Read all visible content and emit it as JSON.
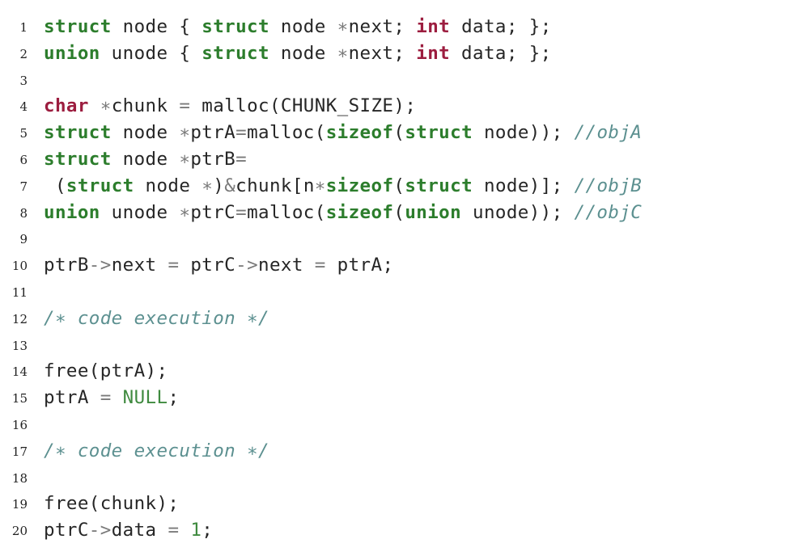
{
  "listing": {
    "lines": [
      {
        "number": "1",
        "tokens": [
          {
            "text": "struct",
            "kind": "type"
          },
          {
            "text": " node { ",
            "kind": "plain"
          },
          {
            "text": "struct",
            "kind": "type"
          },
          {
            "text": " node ",
            "kind": "plain"
          },
          {
            "text": "∗",
            "kind": "op"
          },
          {
            "text": "next; ",
            "kind": "plain"
          },
          {
            "text": "int",
            "kind": "prim"
          },
          {
            "text": " data; };",
            "kind": "plain"
          }
        ]
      },
      {
        "number": "2",
        "tokens": [
          {
            "text": "union",
            "kind": "type"
          },
          {
            "text": " unode { ",
            "kind": "plain"
          },
          {
            "text": "struct",
            "kind": "type"
          },
          {
            "text": " node ",
            "kind": "plain"
          },
          {
            "text": "∗",
            "kind": "op"
          },
          {
            "text": "next; ",
            "kind": "plain"
          },
          {
            "text": "int",
            "kind": "prim"
          },
          {
            "text": " data; };",
            "kind": "plain"
          }
        ]
      },
      {
        "number": "3",
        "tokens": []
      },
      {
        "number": "4",
        "tokens": [
          {
            "text": "char",
            "kind": "prim"
          },
          {
            "text": " ",
            "kind": "plain"
          },
          {
            "text": "∗",
            "kind": "op"
          },
          {
            "text": "chunk ",
            "kind": "plain"
          },
          {
            "text": "=",
            "kind": "op"
          },
          {
            "text": " malloc(CHUNK_SIZE);",
            "kind": "plain"
          }
        ]
      },
      {
        "number": "5",
        "tokens": [
          {
            "text": "struct",
            "kind": "type"
          },
          {
            "text": " node ",
            "kind": "plain"
          },
          {
            "text": "∗",
            "kind": "op"
          },
          {
            "text": "ptrA",
            "kind": "plain"
          },
          {
            "text": "=",
            "kind": "op"
          },
          {
            "text": "malloc(",
            "kind": "plain"
          },
          {
            "text": "sizeof",
            "kind": "type"
          },
          {
            "text": "(",
            "kind": "plain"
          },
          {
            "text": "struct",
            "kind": "type"
          },
          {
            "text": " node)); ",
            "kind": "plain"
          },
          {
            "text": "//objA",
            "kind": "comment"
          }
        ]
      },
      {
        "number": "6",
        "tokens": [
          {
            "text": "struct",
            "kind": "type"
          },
          {
            "text": " node ",
            "kind": "plain"
          },
          {
            "text": "∗",
            "kind": "op"
          },
          {
            "text": "ptrB",
            "kind": "plain"
          },
          {
            "text": "=",
            "kind": "op"
          }
        ]
      },
      {
        "number": "7",
        "tokens": [
          {
            "text": " (",
            "kind": "plain"
          },
          {
            "text": "struct",
            "kind": "type"
          },
          {
            "text": " node ",
            "kind": "plain"
          },
          {
            "text": "∗",
            "kind": "op"
          },
          {
            "text": ")",
            "kind": "plain"
          },
          {
            "text": "&",
            "kind": "op"
          },
          {
            "text": "chunk[n",
            "kind": "plain"
          },
          {
            "text": "∗",
            "kind": "op"
          },
          {
            "text": "sizeof",
            "kind": "type"
          },
          {
            "text": "(",
            "kind": "plain"
          },
          {
            "text": "struct",
            "kind": "type"
          },
          {
            "text": " node)]; ",
            "kind": "plain"
          },
          {
            "text": "//objB",
            "kind": "comment"
          }
        ]
      },
      {
        "number": "8",
        "tokens": [
          {
            "text": "union",
            "kind": "type"
          },
          {
            "text": " unode ",
            "kind": "plain"
          },
          {
            "text": "∗",
            "kind": "op"
          },
          {
            "text": "ptrC",
            "kind": "plain"
          },
          {
            "text": "=",
            "kind": "op"
          },
          {
            "text": "malloc(",
            "kind": "plain"
          },
          {
            "text": "sizeof",
            "kind": "type"
          },
          {
            "text": "(",
            "kind": "plain"
          },
          {
            "text": "union",
            "kind": "type"
          },
          {
            "text": " unode)); ",
            "kind": "plain"
          },
          {
            "text": "//objC",
            "kind": "comment"
          }
        ]
      },
      {
        "number": "9",
        "tokens": []
      },
      {
        "number": "10",
        "tokens": [
          {
            "text": "ptrB",
            "kind": "plain"
          },
          {
            "text": "->",
            "kind": "op"
          },
          {
            "text": "next ",
            "kind": "plain"
          },
          {
            "text": "=",
            "kind": "op"
          },
          {
            "text": " ptrC",
            "kind": "plain"
          },
          {
            "text": "->",
            "kind": "op"
          },
          {
            "text": "next ",
            "kind": "plain"
          },
          {
            "text": "=",
            "kind": "op"
          },
          {
            "text": " ptrA;",
            "kind": "plain"
          }
        ]
      },
      {
        "number": "11",
        "tokens": []
      },
      {
        "number": "12",
        "tokens": [
          {
            "text": "/∗ code execution ∗/",
            "kind": "comment"
          }
        ]
      },
      {
        "number": "13",
        "tokens": []
      },
      {
        "number": "14",
        "tokens": [
          {
            "text": "free(ptrA);",
            "kind": "plain"
          }
        ]
      },
      {
        "number": "15",
        "tokens": [
          {
            "text": "ptrA ",
            "kind": "plain"
          },
          {
            "text": "=",
            "kind": "op"
          },
          {
            "text": " ",
            "kind": "plain"
          },
          {
            "text": "NULL",
            "kind": "lit"
          },
          {
            "text": ";",
            "kind": "plain"
          }
        ]
      },
      {
        "number": "16",
        "tokens": []
      },
      {
        "number": "17",
        "tokens": [
          {
            "text": "/∗ code execution ∗/",
            "kind": "comment"
          }
        ]
      },
      {
        "number": "18",
        "tokens": []
      },
      {
        "number": "19",
        "tokens": [
          {
            "text": "free(chunk);",
            "kind": "plain"
          }
        ]
      },
      {
        "number": "20",
        "tokens": [
          {
            "text": "ptrC",
            "kind": "plain"
          },
          {
            "text": "->",
            "kind": "op"
          },
          {
            "text": "data ",
            "kind": "plain"
          },
          {
            "text": "=",
            "kind": "op"
          },
          {
            "text": " ",
            "kind": "plain"
          },
          {
            "text": "1",
            "kind": "lit"
          },
          {
            "text": ";",
            "kind": "plain"
          }
        ]
      }
    ]
  },
  "colors": {
    "type_keyword": "#2c7d2c",
    "primitive_keyword": "#9c1d3f",
    "plain_text": "#262626",
    "operator": "#7a7a7a",
    "literal": "#3f8a3f",
    "comment": "#5c9090",
    "background": "#ffffff"
  }
}
